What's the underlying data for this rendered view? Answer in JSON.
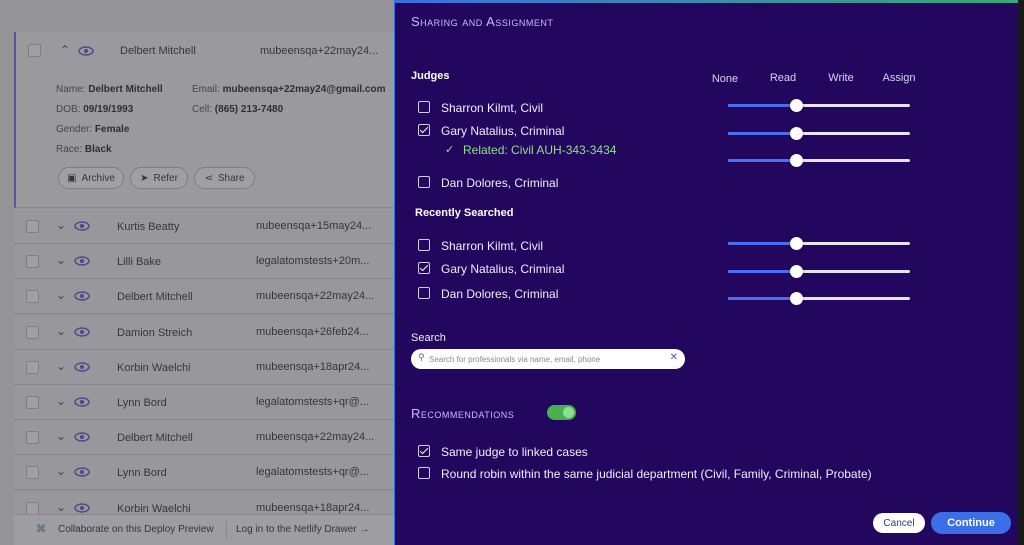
{
  "list": {
    "expanded": {
      "name": "Delbert Mitchell",
      "email_short": "mubeensqa+22may24...",
      "details": {
        "name_label": "Name:",
        "name": "Delbert Mitchell",
        "email_label": "Email:",
        "email": "mubeensqa+22may24@gmail.com",
        "dob_label": "DOB:",
        "dob": "09/19/1993",
        "cell_label": "Cell:",
        "cell": "(865) 213-7480",
        "gender_label": "Gender:",
        "gender": "Female",
        "race_label": "Race:",
        "race": "Black"
      },
      "actions": {
        "archive": "Archive",
        "refer": "Refer",
        "share": "Share"
      }
    },
    "rows": [
      {
        "name": "Kurtis Beatty",
        "email": "nubeensqa+15may24..."
      },
      {
        "name": "Lilli Bake",
        "email": "legalatomstests+20m..."
      },
      {
        "name": "Delbert Mitchell",
        "email": "mubeensqa+22may24..."
      },
      {
        "name": "Damion Streich",
        "email": "mubeensqa+26feb24..."
      },
      {
        "name": "Korbin Waelchi",
        "email": "mubeensqa+18apr24..."
      },
      {
        "name": "Lynn Bord",
        "email": "legalatomstests+qr@..."
      },
      {
        "name": "Delbert Mitchell",
        "email": "mubeensqa+22may24..."
      },
      {
        "name": "Lynn Bord",
        "email": "legalatomstests+qr@..."
      },
      {
        "name": "Korbin Waelchi",
        "email": "mubeensqa+18apr24..."
      }
    ],
    "footer": {
      "collaborate": "Collaborate on this Deploy Preview",
      "login": "Log in to the Netlify Drawer →"
    }
  },
  "panel": {
    "title": "Sharing and Assignment",
    "judges_heading": "Judges",
    "columns": [
      "None",
      "Read",
      "Write",
      "Assign"
    ],
    "judges": [
      {
        "label": "Sharron Kilmt, Civil",
        "checked": false,
        "level": 1
      },
      {
        "label": "Gary Natalius, Criminal",
        "checked": true,
        "level": 1
      },
      {
        "label": "Dan Dolores, Criminal",
        "checked": false
      }
    ],
    "related": {
      "label": "Related: Civil AUH-343-3434",
      "level": 1
    },
    "recent_heading": "Recently Searched",
    "recent": [
      {
        "label": "Sharron Kilmt, Civil",
        "checked": false,
        "level": 1
      },
      {
        "label": "Gary Natalius, Criminal",
        "checked": true,
        "level": 1
      },
      {
        "label": "Dan Dolores, Criminal",
        "checked": false,
        "level": 1
      }
    ],
    "search_label": "Search",
    "search_placeholder": "Search for professionals via name, email, phone",
    "recommendations_heading": "Recommendations",
    "recommendations_enabled": true,
    "options": [
      {
        "label": "Same judge to linked cases",
        "checked": true
      },
      {
        "label": "Round robin within the same judicial department (Civil, Family, Criminal, Probate)",
        "checked": false
      }
    ],
    "cancel": "Cancel",
    "continue": "Continue"
  },
  "colors": {
    "panel_bg": "#23075e",
    "accent": "#3b6fe8",
    "related_green": "#8fe08a",
    "toggle_green": "#49b04f"
  }
}
